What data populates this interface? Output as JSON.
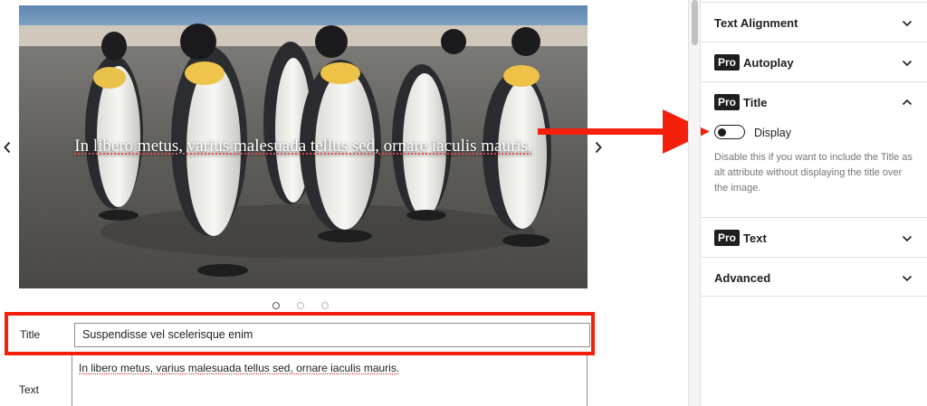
{
  "slider": {
    "caption": "In libero metus, varius malesuada tellus sed, ornare iaculis mauris.",
    "prev_icon": "chevron-left-icon",
    "next_icon": "chevron-right-icon",
    "dots": [
      {
        "active": true
      },
      {
        "active": false
      },
      {
        "active": false
      }
    ]
  },
  "form": {
    "title_label": "Title",
    "title_value": "Suspendisse vel scelerisque enim",
    "text_label": "Text",
    "text_value": "In libero metus, varius malesuada tellus sed, ornare iaculis mauris."
  },
  "sidebar": {
    "panels": [
      {
        "label": "Text Alignment",
        "pro": false,
        "expanded": false
      },
      {
        "label": "Autoplay",
        "pro": true,
        "expanded": false
      },
      {
        "label": "Title",
        "pro": true,
        "expanded": true
      },
      {
        "label": "Text",
        "pro": true,
        "expanded": false
      },
      {
        "label": "Advanced",
        "pro": false,
        "expanded": false
      }
    ],
    "pro_badge": "Pro",
    "title_panel": {
      "toggle_label": "Display",
      "toggle_on": false,
      "help": "Disable this if you want to include the Title as alt attribute without displaying the title over the image."
    }
  },
  "colors": {
    "highlight": "#f5200b",
    "pro_badge_bg": "#1e1e1e"
  }
}
